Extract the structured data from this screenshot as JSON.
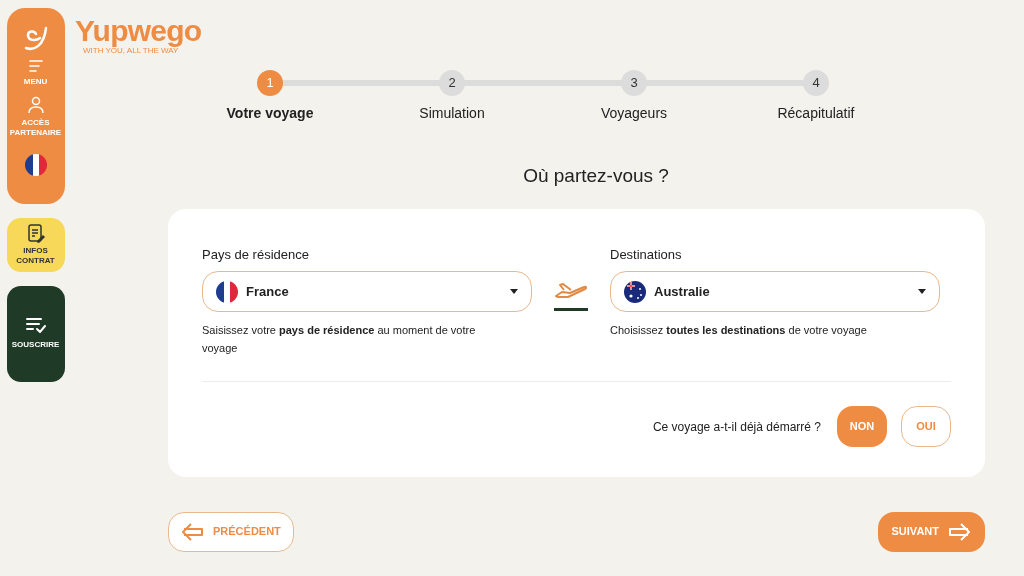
{
  "sidebar": {
    "items": [
      {
        "kind": "menu",
        "label": "MENU"
      },
      {
        "kind": "partner",
        "label": "ACCÈS PARTENAIRE"
      },
      {
        "kind": "language"
      }
    ],
    "contract": {
      "label": "INFOS CONTRAT"
    },
    "subscribe": {
      "label": "SOUSCRIRE"
    }
  },
  "logo": {
    "name": "Yupwego",
    "tagline": "WITH YOU, ALL THE WAY"
  },
  "steps": [
    {
      "number": "1",
      "label": "Votre voyage",
      "selected": true
    },
    {
      "number": "2",
      "label": "Simulation",
      "selected": false
    },
    {
      "number": "3",
      "label": "Voyageurs",
      "selected": false
    },
    {
      "number": "4",
      "label": "Récapitulatif",
      "selected": false
    }
  ],
  "heading": "Où partez-vous ?",
  "residence": {
    "label": "Pays de résidence",
    "value": "France",
    "kind": "france",
    "hint": "Saisissez votre **pays de résidence** au moment de votre voyage"
  },
  "destination": {
    "label": "Destinations",
    "value": "Australie",
    "kind": "australia",
    "hint": "Choisissez **toutes les destinations** de votre voyage"
  },
  "started": {
    "question": "Ce voyage a-t-il déjà démarré ?",
    "options": [
      {
        "label": "NON",
        "selected": true
      },
      {
        "label": "OUI",
        "selected": false
      }
    ]
  },
  "nav": {
    "previous": "PRÉCÉDENT",
    "next": "SUIVANT"
  }
}
